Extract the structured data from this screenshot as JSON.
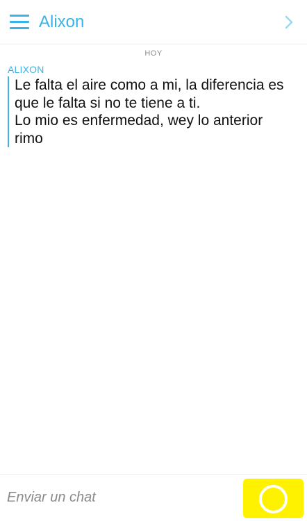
{
  "header": {
    "title": "Alixon",
    "menu_icon": "hamburger-menu-icon",
    "next_icon": "chevron-right-icon"
  },
  "chat": {
    "date_separator": "HOY",
    "sender": "ALIXON",
    "message_lines": [
      "Le falta el aire como a mi, la diferencia es",
      "que le falta si no te tiene a ti.",
      "Lo mio es enfermedad, wey lo anterior",
      "rimo"
    ]
  },
  "composer": {
    "placeholder": "Enviar un chat",
    "capture_icon": "camera-capture-ring-icon"
  },
  "colors": {
    "accent": "#3bb3e6",
    "capture_button": "#fff200",
    "text": "#111111",
    "muted": "#8c8c8c"
  }
}
